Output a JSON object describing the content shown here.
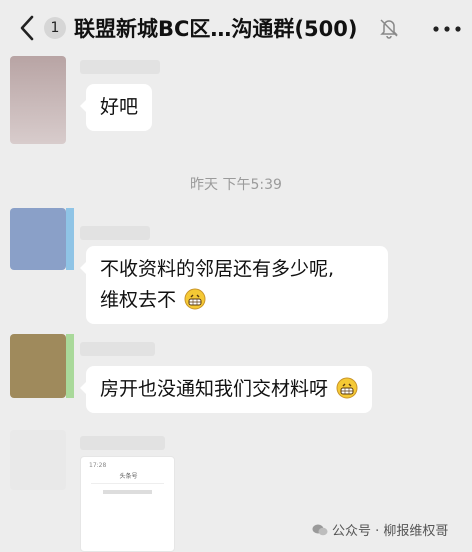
{
  "header": {
    "back_icon": "chevron-left-icon",
    "unread_count": "1",
    "title": "联盟新城BC区…沟通群(500)",
    "mute_icon": "bell-off-icon",
    "more_icon": "more-dots-icon"
  },
  "messages": [
    {
      "text": "好吧",
      "avatar_color": "#c9b8b8"
    },
    {
      "timestamp": "昨天 下午5:39"
    },
    {
      "line1": "不收资料的邻居还有多少呢,",
      "line2": "维权去不",
      "emoji": "grin-emoji",
      "avatar_color": "#8aa0c8"
    },
    {
      "text": "房开也没通知我们交材料呀",
      "emoji": "grin-emoji",
      "avatar_color": "#9f8a5c"
    },
    {
      "type": "image",
      "preview_status": "17:28",
      "preview_title": "头条号",
      "avatar_color": "#e9e9e9"
    }
  ],
  "watermark": {
    "text": "公众号 · 柳报维权哥",
    "icon": "wechat-icon"
  }
}
